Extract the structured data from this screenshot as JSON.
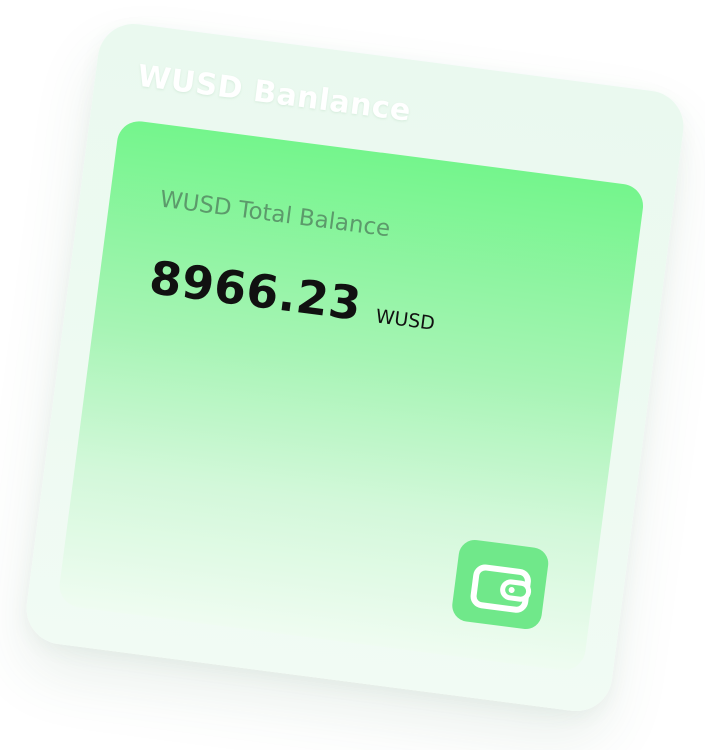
{
  "card": {
    "title": "WUSD Banlance"
  },
  "balance": {
    "label": "WUSD Total Balance",
    "value": "8966.23",
    "unit": "WUSD"
  },
  "wallet": {
    "icon": "wallet-icon"
  },
  "colors": {
    "accent_green": "#70e88a",
    "label_green": "#5c9a6b",
    "value_text": "#111111"
  }
}
